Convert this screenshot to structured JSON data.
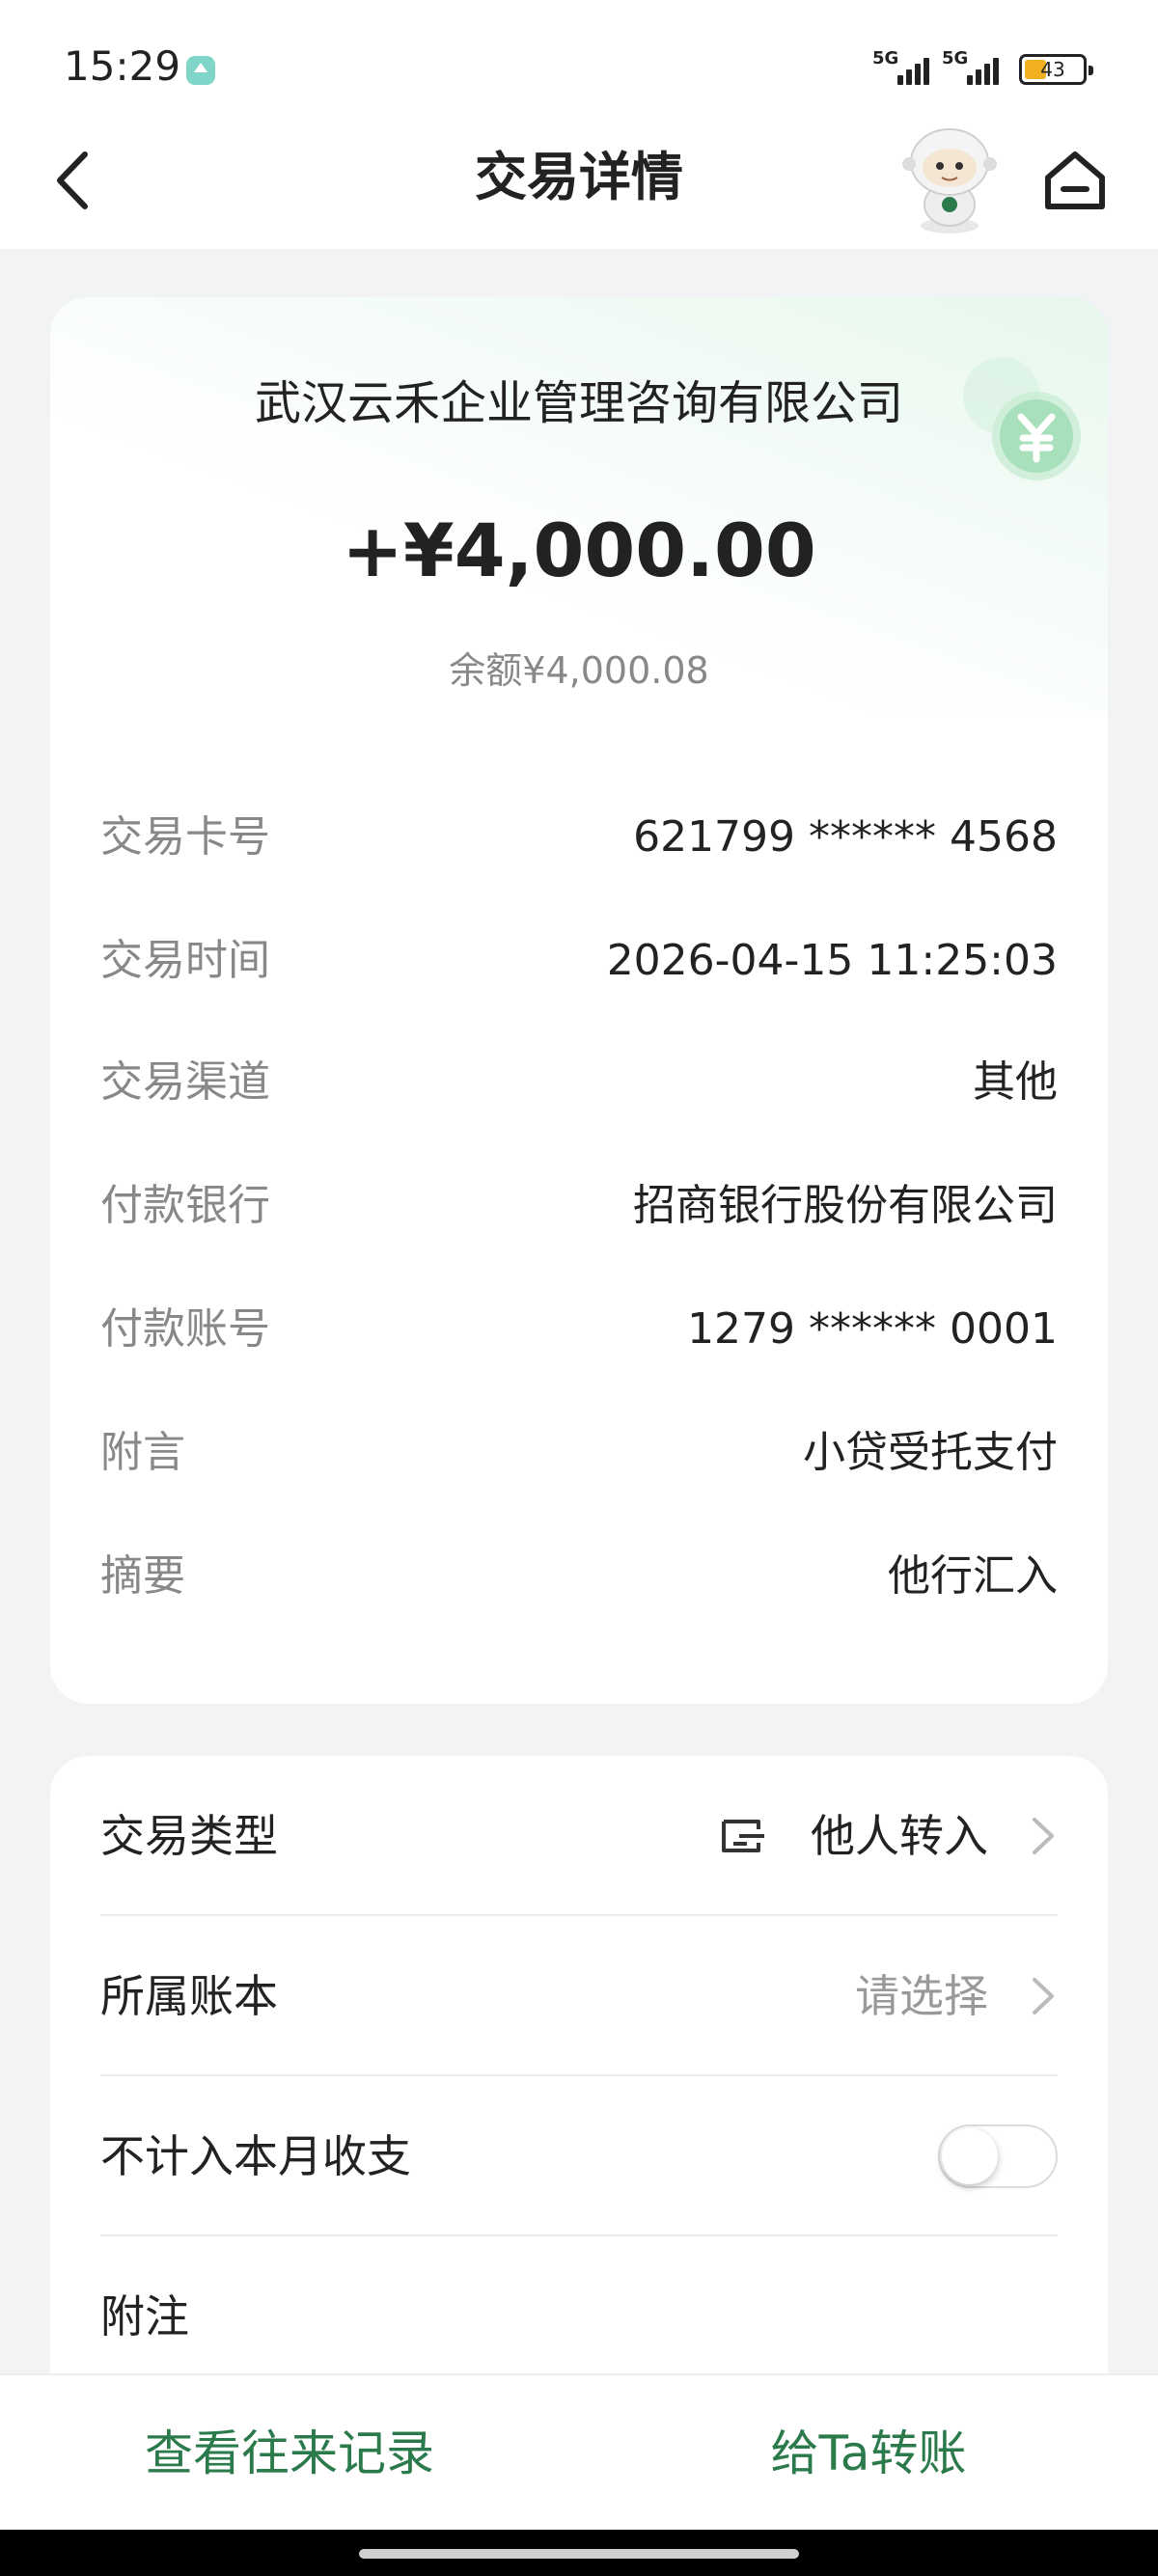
{
  "status_bar": {
    "time": "15:29",
    "network_1": "5G",
    "network_2": "5G",
    "battery": "43"
  },
  "header": {
    "title": "交易详情"
  },
  "transaction": {
    "merchant": "武汉云禾企业管理咨询有限公司",
    "amount": "+¥4,000.00",
    "balance": "余额¥4,000.08",
    "details": [
      {
        "label": "交易卡号",
        "value": "621799 ****** 4568"
      },
      {
        "label": "交易时间",
        "value": "2026-04-15 11:25:03"
      },
      {
        "label": "交易渠道",
        "value": "其他"
      },
      {
        "label": "付款银行",
        "value": "招商银行股份有限公司"
      },
      {
        "label": "付款账号",
        "value": "1279 ****** 0001"
      },
      {
        "label": "附言",
        "value": "小贷受托支付"
      },
      {
        "label": "摘要",
        "value": "他行汇入"
      }
    ]
  },
  "settings": {
    "type_label": "交易类型",
    "type_value": "他人转入",
    "book_label": "所属账本",
    "book_placeholder": "请选择",
    "exclude_label": "不计入本月收支",
    "exclude_enabled": false,
    "note_label": "附注"
  },
  "bottom_actions": {
    "history": "查看往来记录",
    "transfer": "给Ta转账"
  },
  "colors": {
    "accent": "#2b7a4b",
    "coin": "#8fd6a5"
  }
}
